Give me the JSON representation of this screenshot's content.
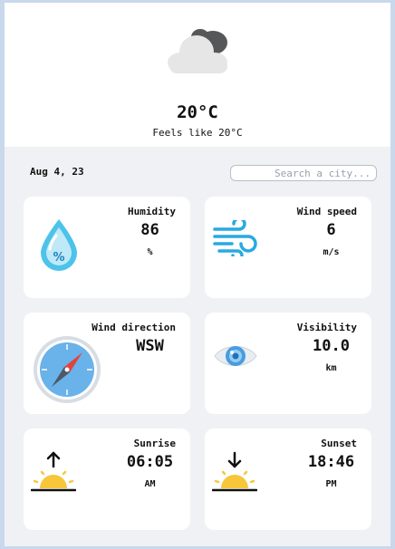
{
  "current": {
    "temperature": "20°C",
    "feels_like": "Feels like 20°C",
    "condition_icon": "cloud-icon"
  },
  "date": "Aug 4, 23",
  "search": {
    "placeholder": "Search a city..."
  },
  "cards": [
    {
      "label": "Humidity",
      "value": "86",
      "unit": "%",
      "icon": "water-drop-icon"
    },
    {
      "label": "Wind speed",
      "value": "6",
      "unit": "m/s",
      "icon": "wind-icon"
    },
    {
      "label": "Wind direction",
      "value": "WSW",
      "unit": "",
      "icon": "compass-icon"
    },
    {
      "label": "Visibility",
      "value": "10.0",
      "unit": "km",
      "icon": "eye-icon"
    },
    {
      "label": "Sunrise",
      "value": "06:05",
      "unit": "AM",
      "icon": "sunrise-icon"
    },
    {
      "label": "Sunset",
      "value": "18:46",
      "unit": "PM",
      "icon": "sunset-icon"
    }
  ],
  "colors": {
    "background": "#eff1f4",
    "card": "#ffffff",
    "accent_blue": "#29a9e1",
    "sun": "#f7c63a"
  }
}
